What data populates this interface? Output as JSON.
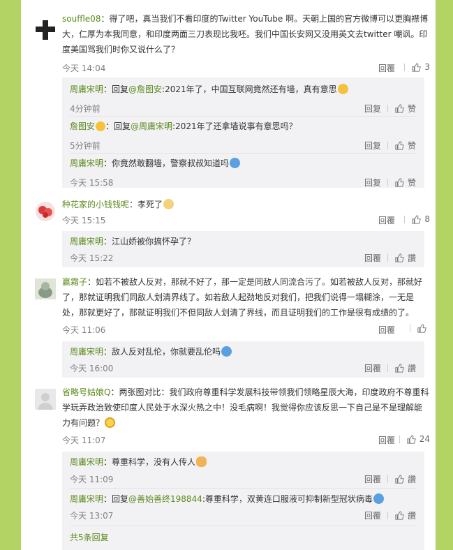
{
  "comments": [
    {
      "user": "souffle08",
      "text": "：得了吧，真当我们不看印度的Twitter YouTube 啊。天朝上国的官方微博可以更胸襟博大，仁厚为本我同意，和印度两面三刀表现比我呸。我们中国长安网又没用英文去twitter 嘲讽。印度美国骂我们时你又说什么了？",
      "time": "今天 14:04",
      "reply": "回覆",
      "likes": "3",
      "subs": [
        {
          "user": "周庸宋明",
          "prefix": "：回复",
          "mention": "@詹图安",
          "text": ":2021年了，中国互联网竟然还有墙，真有意思",
          "time": "4分钟前",
          "reply": "回复",
          "like": "赞"
        },
        {
          "user": "詹图安",
          "prefix": "：回复",
          "mention": "@周庸宋明",
          "text": ":2021年了还拿墙说事有意思吗？",
          "time": "5分钟前",
          "reply": "回复",
          "like": "赞"
        },
        {
          "user": "周庸宋明",
          "prefix": "：你竟然敢翻墙，警察叔叔知道吗",
          "mention": "",
          "text": "",
          "time": "今天 15:58",
          "reply": "回复",
          "like": "赞"
        }
      ]
    },
    {
      "user": "种花家的小钱钱呢",
      "text": "：孝死了",
      "time": "今天 15:15",
      "reply": "回覆",
      "likes": "8",
      "subs": [
        {
          "user": "周庸宋明",
          "prefix": "：江山娇被你搞怀孕了？",
          "mention": "",
          "text": "",
          "time": "今天 15:22",
          "reply": "回覆",
          "like": "讚"
        }
      ]
    },
    {
      "user": "赢霜子",
      "text": "：如若不被敌人反对，那就不好了，那一定是同敌人同流合污了。如若被敌人反对，那就好了，那就证明我们同敌人划清界线了。如若敌人起劲地反对我们，把我们说得一塌糊涂，一无是处，那就更好了，那就证明我们不但同敌人划清了界线，而且证明我们的工作是很有成绩的了。",
      "time": "今天 11:06",
      "reply": "回覆",
      "likes": "",
      "subs": [
        {
          "user": "周庸宋明",
          "prefix": "：敌人反对乱伦，你就要乱伦吗",
          "mention": "",
          "text": "",
          "time": "今天 16:00",
          "reply": "回覆",
          "like": "讚"
        }
      ]
    },
    {
      "user": "省略号姑娘Q",
      "text": "：两张图对比：我们政府尊重科学发展科技带领我们领略星辰大海，印度政府不尊重科学玩弄政治致使印度人民处于水深火热之中！没毛病啊！我觉得你应该反思一下自己是不是理解能力有问题？",
      "time": "今天 11:07",
      "reply": "回覆",
      "likes": "24",
      "subs": [
        {
          "user": "周庸宋明",
          "prefix": "：尊重科学，没有人传人",
          "mention": "",
          "text": "",
          "time": "今天 11:09",
          "reply": "回覆",
          "like": "讚"
        },
        {
          "user": "周庸宋明",
          "prefix": "：回复",
          "mention": "@善始善终198844",
          "text": ":尊重科学，双黄连口服液可抑制新型冠状病毒",
          "time": "今天 13:07",
          "reply": "回覆",
          "like": "讚"
        }
      ],
      "more": "共5条回复"
    }
  ],
  "colors": {
    "background": "#b3d465",
    "username": "#5b8a1a",
    "subbox": "#f2f2f5"
  }
}
